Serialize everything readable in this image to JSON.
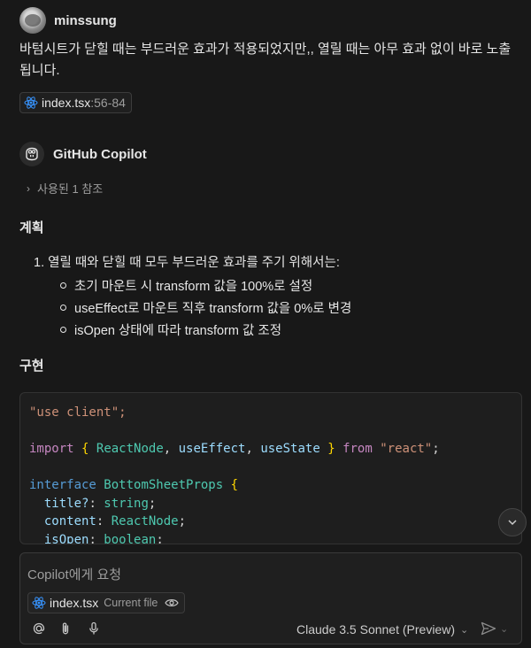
{
  "user": {
    "name": "minssung",
    "message": "바텀시트가 닫힐 때는 부드러운 효과가 적용되었지만,, 열릴 때는 아무 효과 없이 바로 노출됩니다.",
    "reference": {
      "file": "index.tsx",
      "lines": ":56-84"
    }
  },
  "copilot": {
    "name": "GitHub Copilot",
    "refs_label": "사용된 1 참조",
    "plan_heading": "계획",
    "plan_item": "1. 열릴 때와 닫힐 때 모두 부드러운 효과를 주기 위해서는:",
    "plan_subitems": [
      "초기 마운트 시 transform 값을 100%로 설정",
      "useEffect로 마운트 직후 transform 값을 0%로 변경",
      "isOpen 상태에 따라 transform 값 조정"
    ],
    "impl_heading": "구현"
  },
  "code": {
    "line1": "\"use client\";",
    "import_kw": "import",
    "import_names": [
      "ReactNode",
      "useEffect",
      "useState"
    ],
    "from_kw": "from",
    "import_src": "\"react\"",
    "interface_kw": "interface",
    "interface_name": "BottomSheetProps",
    "props": [
      {
        "name": "title?",
        "type": "string"
      },
      {
        "name": "content",
        "type": "ReactNode"
      },
      {
        "name": "isOpen",
        "type": "boolean"
      }
    ]
  },
  "input": {
    "placeholder": "Copilot에게 요청",
    "file": "index.tsx",
    "file_tag": "Current file",
    "model": "Claude 3.5 Sonnet (Preview)"
  },
  "colors": {
    "background": "#181818",
    "react_blue": "#3794ff",
    "string": "#ce9178",
    "keyword": "#c586c0",
    "type": "#4ec9b0"
  }
}
